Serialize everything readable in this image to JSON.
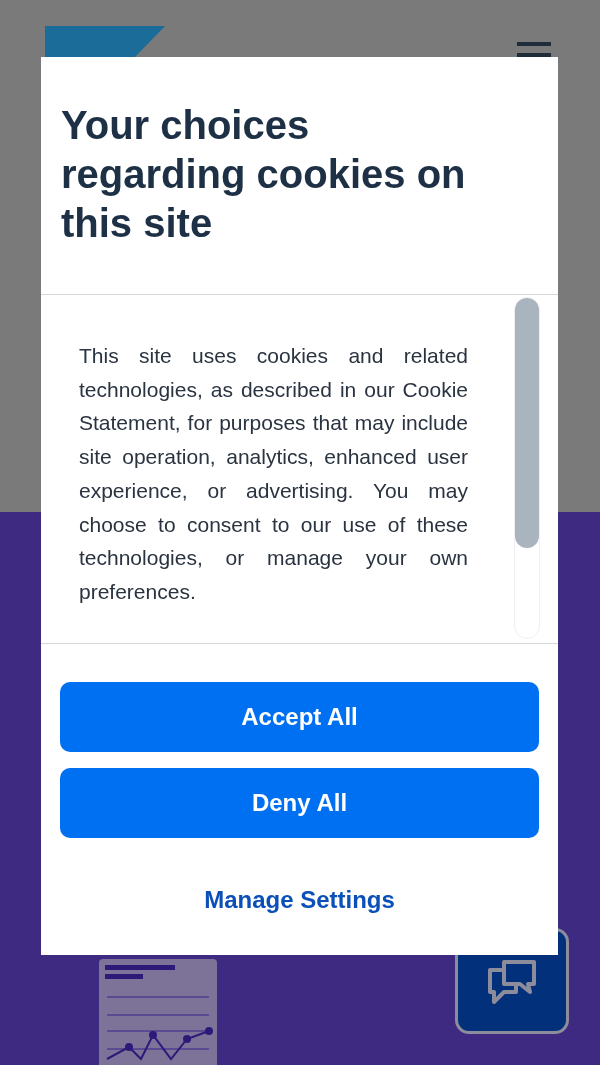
{
  "cookie_dialog": {
    "title": "Your choices regarding cookies on this site",
    "body": "This site uses cookies and related technologies, as described in our Cookie Statement, for purposes that may include site operation, analytics, enhanced user experience, or advertising. You may choose to consent to our use of these technologies, or manage your own preferences.",
    "buttons": [
      {
        "label": "Accept All",
        "kind": "primary"
      },
      {
        "label": "Deny All",
        "kind": "primary"
      },
      {
        "label": "Manage Settings",
        "kind": "link"
      }
    ]
  }
}
